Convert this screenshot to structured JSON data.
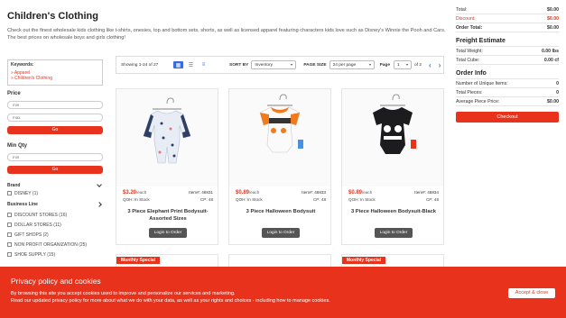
{
  "page": {
    "title": "Children's Clothing",
    "description": "Check out the finest wholesale kids clothing like t-shirts, onesies, top and bottom sets, shorts, as well as licensed apparel featuring characters kids love such as Disney's Winnie the Pooh and Cars. The best prices on wholesale boys and girls clothing!"
  },
  "filters": {
    "keywords_title": "Keywords:",
    "keywords": [
      "» Apparel",
      "» Children's Clothing"
    ],
    "price_label": "Price",
    "price_min_placeholder": "min",
    "price_max_placeholder": "max",
    "price_go": "Go",
    "minqty_label": "Min Qty",
    "minqty_placeholder": "min",
    "minqty_go": "Go",
    "brand_label": "Brand",
    "brands": [
      "DISNEY (1)"
    ],
    "business_line_label": "Business Line",
    "business_lines": [
      "DISCOUNT STORES (16)",
      "DOLLAR STORES (11)",
      "GIFT SHOPS (2)",
      "NON PROFIT ORGANIZATION (25)",
      "SHOE SUPPLY (15)"
    ]
  },
  "toolbar": {
    "showing": "Showing 1-24 of 27",
    "sort_label": "SORT BY",
    "sort_value": "Inventory",
    "page_size_label": "PAGE SIZE",
    "page_size_value": "24 per page",
    "page_label": "Page",
    "page_value": "1",
    "page_of": "of 2"
  },
  "products": [
    {
      "price": "$3.20",
      "per": "/each",
      "item": "Item#: 46831",
      "qoh": "QOH: In Stock",
      "cp": "CP: 48",
      "name": "3 Piece Elephant Print Bodysuit-Assorted Sizes",
      "button": "Login to Order"
    },
    {
      "price": "$0.89",
      "per": "/each",
      "item": "Item#: 46833",
      "qoh": "QOH: In Stock",
      "cp": "CP: 48",
      "name": "3 Piece Halloween Bodysuit",
      "button": "Login to Order"
    },
    {
      "price": "$0.89",
      "per": "/each",
      "item": "Item#: 46834",
      "qoh": "QOH: In Stock",
      "cp": "CP: 48",
      "name": "3 Piece Halloween Bodysuit-Black",
      "button": "Login to Order"
    }
  ],
  "ribbons": [
    "Monthly Special",
    "Monthly Special"
  ],
  "summary": {
    "total_label": "Total:",
    "total_value": "$0.00",
    "discount_label": "Discount:",
    "discount_value": "$0.00",
    "order_total_label": "Order Total:",
    "order_total_value": "$0.00",
    "freight_head": "Freight Estimate",
    "weight_label": "Total Weight:",
    "weight_value": "0.00 lbs",
    "cube_label": "Total Cube:",
    "cube_value": "0.00 cf",
    "order_info_head": "Order Info",
    "unique_label": "Number of Unique Items:",
    "unique_value": "0",
    "pieces_label": "Total Pieces:",
    "pieces_value": "0",
    "avg_label": "Average Piece Price:",
    "avg_value": "$0.00",
    "checkout": "Checkout"
  },
  "cookie": {
    "title": "Privacy policy and cookies",
    "line1": "By browsing this site you accept cookies used to improve and personalize our services and marketing.",
    "line2": "Read our updated privacy policy for more about what we do with your data, as well as your rights and choices - including how to manage cookies.",
    "accept": "Accept & close"
  },
  "colors": {
    "accent": "#e8321b",
    "blue": "#3a6bd8"
  }
}
